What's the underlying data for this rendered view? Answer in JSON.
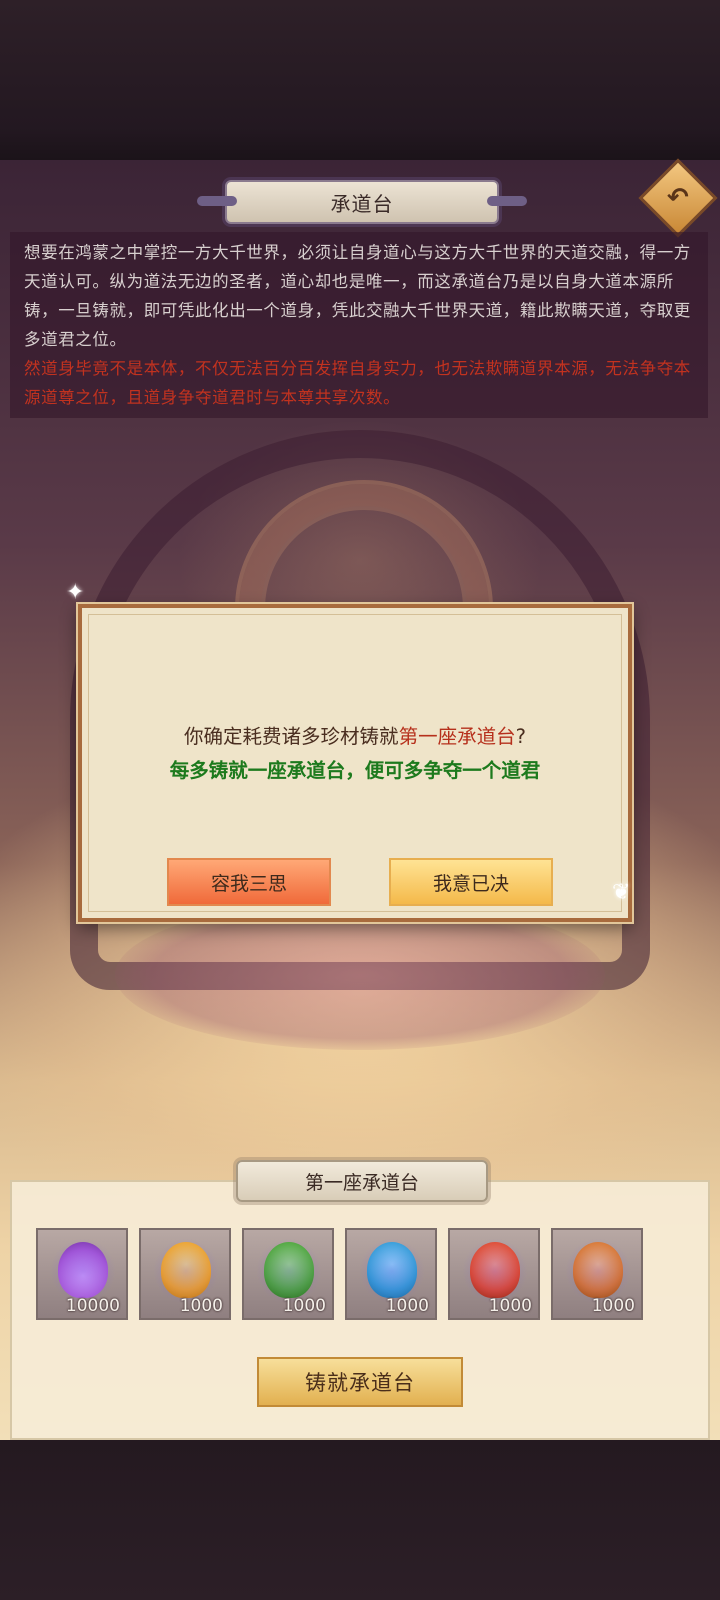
{
  "header": {
    "title": "承道台",
    "back_icon": "back-arrow-icon"
  },
  "description": {
    "main": "想要在鸿蒙之中掌控一方大千世界，必须让自身道心与这方大千世界的天道交融，得一方天道认可。纵为道法无边的圣者，道心却也是唯一，而这承道台乃是以自身大道本源所铸，一旦铸就，即可凭此化出一个道身，凭此交融大千世界天道，籍此欺瞒天道，夺取更多道君之位。",
    "warning": "然道身毕竟不是本体，不仅无法百分百发挥自身实力，也无法欺瞒道界本源，无法争夺本源道尊之位，且道身争夺道君时与本尊共享次数。"
  },
  "dialog": {
    "line1_prefix": "你确定耗费诸多珍材铸就",
    "line1_highlight": "第一座承道台",
    "line1_suffix": "?",
    "line2": "每多铸就一座承道台，便可多争夺一个道君",
    "cancel_label": "容我三思",
    "confirm_label": "我意已决"
  },
  "panel": {
    "title": "第一座承道台",
    "materials": [
      {
        "icon": "purple-crystal-icon",
        "color": "#a656d8",
        "qty": "10000"
      },
      {
        "icon": "yellow-gem-icon",
        "color": "#f0a224",
        "qty": "1000"
      },
      {
        "icon": "green-gem-icon",
        "color": "#4aa636",
        "qty": "1000"
      },
      {
        "icon": "blue-gem-icon",
        "color": "#2e9bd6",
        "qty": "1000"
      },
      {
        "icon": "red-gem-icon",
        "color": "#e0462a",
        "qty": "1000"
      },
      {
        "icon": "orange-gem-icon",
        "color": "#d9742a",
        "qty": "1000"
      }
    ],
    "forge_label": "铸就承道台"
  }
}
